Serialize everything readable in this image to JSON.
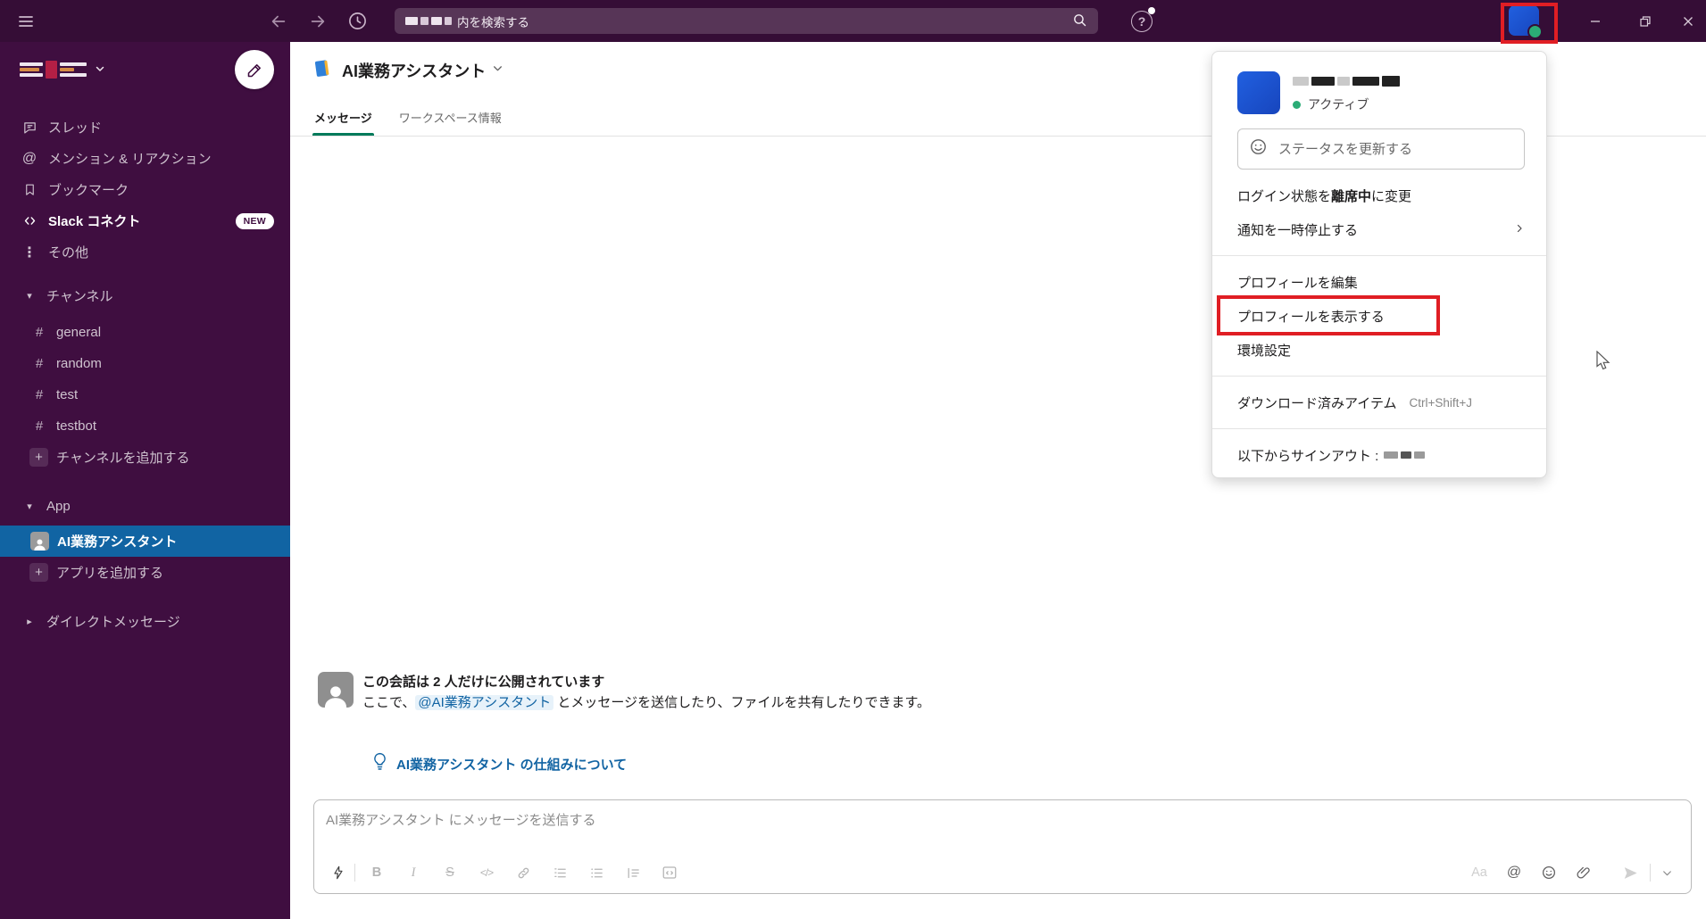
{
  "colors": {
    "titlebar": "#350d36",
    "sidebar": "#3f0e40",
    "selected_blue": "#1164a3",
    "tab_green": "#007a5a",
    "link_blue": "#1264a3",
    "presence_green": "#2bac76",
    "annotation_red": "#e01e24"
  },
  "icons": {
    "hash": "#",
    "at": "@",
    "more": "⋮",
    "caret_down": "▾",
    "caret_right": "▸",
    "help": "?",
    "bold": "B",
    "italic": "I",
    "strike": "S",
    "code": "</>",
    "format_aa": "Aa"
  },
  "titlebar": {
    "search_suffix": "内を検索する"
  },
  "sidebar": {
    "nav": [
      {
        "label": "スレッド"
      },
      {
        "label": "メンション & リアクション"
      },
      {
        "label": "ブックマーク"
      },
      {
        "label": "Slack コネクト",
        "badge": "NEW"
      },
      {
        "label": "その他"
      }
    ],
    "channels_header": "チャンネル",
    "channels": [
      "general",
      "random",
      "test",
      "testbot"
    ],
    "add_channel": "チャンネルを追加する",
    "apps_header": "App",
    "app_item": "AI業務アシスタント",
    "add_app": "アプリを追加する",
    "dm_header": "ダイレクトメッセージ"
  },
  "header": {
    "title": "AI業務アシスタント",
    "tabs": [
      {
        "label": "メッセージ"
      },
      {
        "label": "ワークスペース情報"
      }
    ]
  },
  "conversation": {
    "intro_title": "この会話は 2 人だけに公開されています",
    "intro_before": "ここで、",
    "mention": "@AI業務アシスタント",
    "intro_after": " とメッセージを送信したり、ファイルを共有したりできます。",
    "help_link": "AI業務アシスタント の仕組みについて"
  },
  "composer": {
    "placeholder": "AI業務アシスタント にメッセージを送信する"
  },
  "profile_menu": {
    "active_status": "アクティブ",
    "status_placeholder": "ステータスを更新する",
    "away_pre": "ログイン状態を",
    "away_bold": "離席中",
    "away_post": "に変更",
    "pause_notifications": "通知を一時停止する",
    "edit_profile": "プロフィールを編集",
    "view_profile": "プロフィールを表示する",
    "preferences": "環境設定",
    "downloads": "ダウンロード済みアイテム",
    "downloads_shortcut": "Ctrl+Shift+J",
    "sign_out": "以下からサインアウト :"
  }
}
